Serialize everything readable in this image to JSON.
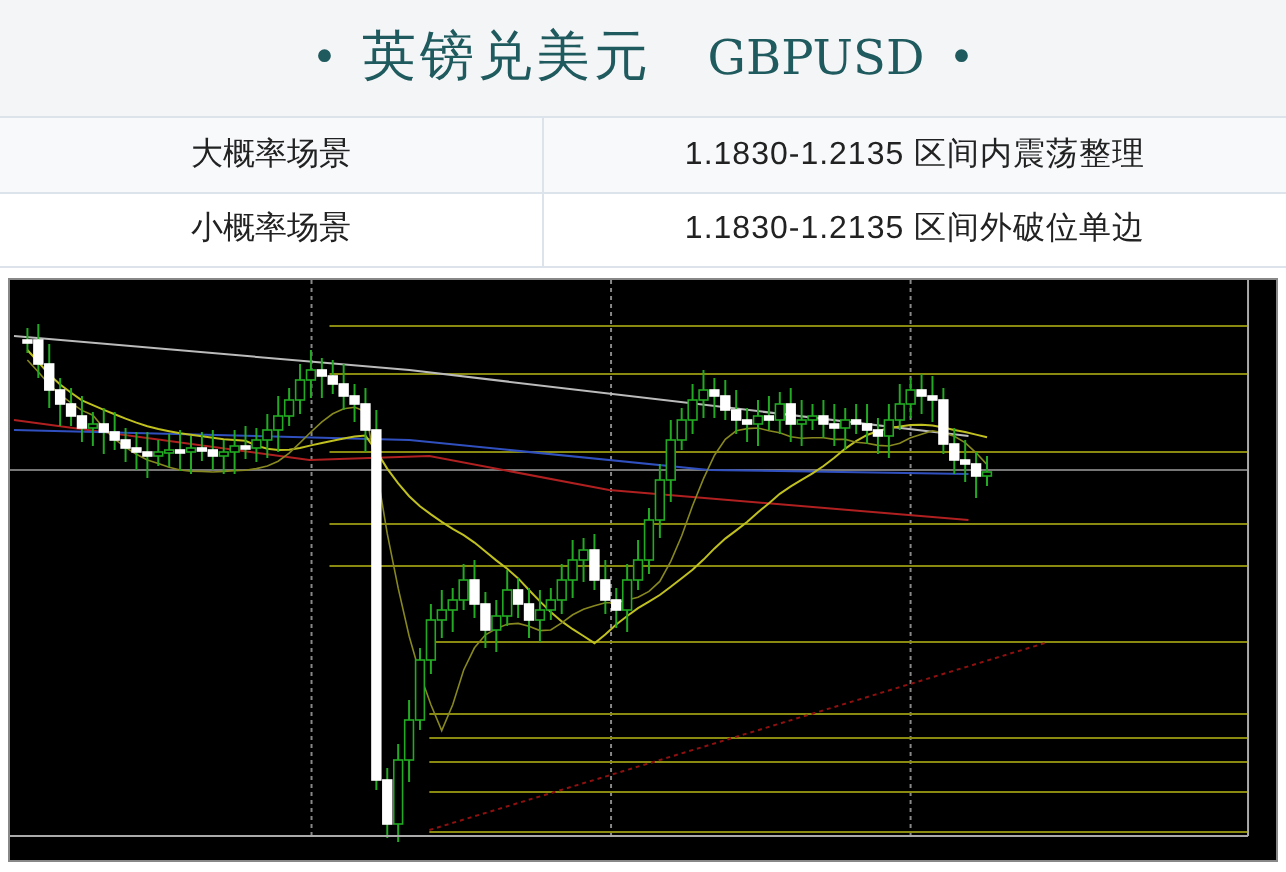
{
  "title": {
    "bullet_left": "•",
    "name": "英镑兑美元",
    "symbol": "GBPUSD",
    "bullet_right": "•"
  },
  "scenarios": [
    {
      "label": "大概率场景",
      "range": "1.1830-1.2135 区间内震荡整理"
    },
    {
      "label": "小概率场景",
      "range": "1.1830-1.2135 区间外破位单边"
    }
  ]
}
